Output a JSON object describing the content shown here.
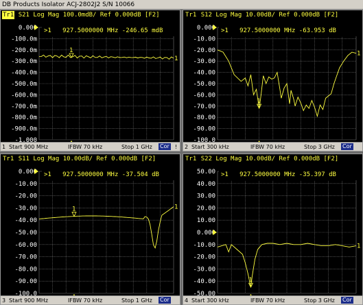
{
  "window": {
    "title": "DB Products Isolator ACJ-2802J2 S/N 10066"
  },
  "colors": {
    "trace": "#ffff40",
    "grid": "#7a7a7a",
    "cor_badge": "#1c2d8a"
  },
  "panels": [
    {
      "id": "s21",
      "trace_label": "Tr1",
      "header": "S21 Log Mag 100.0mdB/ Ref 0.000dB [F2]",
      "y_labels": [
        "0.000",
        "-100.0m",
        "-200.0m",
        "-300.0m",
        "-400.0m",
        "-500.0m",
        "-600.0m",
        "-700.0m",
        "-800.0m",
        "-900.0m",
        "-1.000"
      ],
      "marker_readout": ">1   927.5000000 MHz -246.65 mdB",
      "marker_label": "1",
      "ref_marker": "1",
      "status": {
        "channel": "1",
        "start": "Start 900 MHz",
        "ifbw": "IFBW 70 kHz",
        "stop": "Stop 1 GHz",
        "cor": "Cor",
        "extra": "!"
      }
    },
    {
      "id": "s12",
      "trace_label": "Tr1",
      "header": "S12 Log Mag 10.00dB/ Ref 0.000dB [F2]",
      "y_labels": [
        "0.000",
        "-10.00",
        "-20.00",
        "-30.00",
        "-40.00",
        "-50.00",
        "-60.00",
        "-70.00",
        "-80.00",
        "-90.00",
        "-100.0"
      ],
      "marker_readout": ">1   927.5000000 MHz -63.953 dB",
      "marker_label": "1",
      "ref_marker": "1",
      "status": {
        "channel": "2",
        "start": "Start 300 kHz",
        "ifbw": "IFBW 70 kHz",
        "stop": "Stop 3 GHz",
        "cor": "Cor",
        "extra": ""
      }
    },
    {
      "id": "s11",
      "trace_label": "Tr1",
      "header": "S11 Log Mag 10.00dB/ Ref 0.000dB [F2]",
      "y_labels": [
        "0.000",
        "-10.00",
        "-20.00",
        "-30.00",
        "-40.00",
        "-50.00",
        "-60.00",
        "-70.00",
        "-80.00",
        "-90.00",
        "-100.0"
      ],
      "marker_readout": ">1   927.5000000 MHz -37.504 dB",
      "marker_label": "1",
      "ref_marker": "1",
      "status": {
        "channel": "3",
        "start": "Start 900 MHz",
        "ifbw": "IFBW 70 kHz",
        "stop": "Stop 1 GHz",
        "cor": "Cor",
        "extra": ""
      }
    },
    {
      "id": "s22",
      "trace_label": "Tr1",
      "header": "S22 Log Mag 10.00dB/ Ref 0.000dB [F2]",
      "y_labels": [
        "50.00",
        "40.00",
        "30.00",
        "20.00",
        "10.00",
        "0.000",
        "-10.00",
        "-20.00",
        "-30.00",
        "-40.00",
        "-50.00"
      ],
      "marker_readout": ">1   927.5000000 MHz -35.397 dB",
      "marker_label": "1",
      "ref_marker": "1",
      "status": {
        "channel": "4",
        "start": "Start 300 kHz",
        "ifbw": "IFBW 70 kHz",
        "stop": "Stop 3 GHz",
        "cor": "Cor",
        "extra": ""
      }
    }
  ]
}
